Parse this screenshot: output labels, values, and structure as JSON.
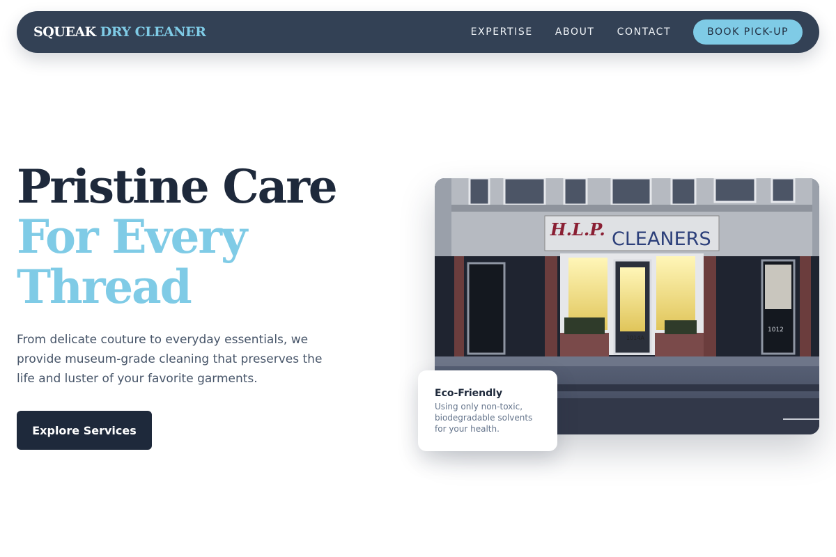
{
  "brand": {
    "part1": "SQUEAK",
    "part2": "DRY CLEANER"
  },
  "nav": {
    "links": [
      "EXPERTISE",
      "ABOUT",
      "CONTACT"
    ],
    "cta_label": "BOOK PICK-UP"
  },
  "hero": {
    "title_line1": "Pristine Care",
    "title_line2": "For Every",
    "title_line3": "Thread",
    "description": "From delicate couture to everyday essentials, we provide museum-grade cleaning that preserves the life and luster of your favorite garments.",
    "cta_label": "Explore Services"
  },
  "photo": {
    "sign_script": "H.L.P.",
    "sign_main": "CLEANERS",
    "address_center": "1014A",
    "address_right": "1012"
  },
  "feature_card": {
    "title": "Eco-Friendly",
    "text": "Using only non-toxic, biodegradable solvents for your health."
  },
  "colors": {
    "nav_bg": "#334155",
    "accent": "#7fcbe6",
    "dark": "#1e293b",
    "body_text": "#475569"
  }
}
